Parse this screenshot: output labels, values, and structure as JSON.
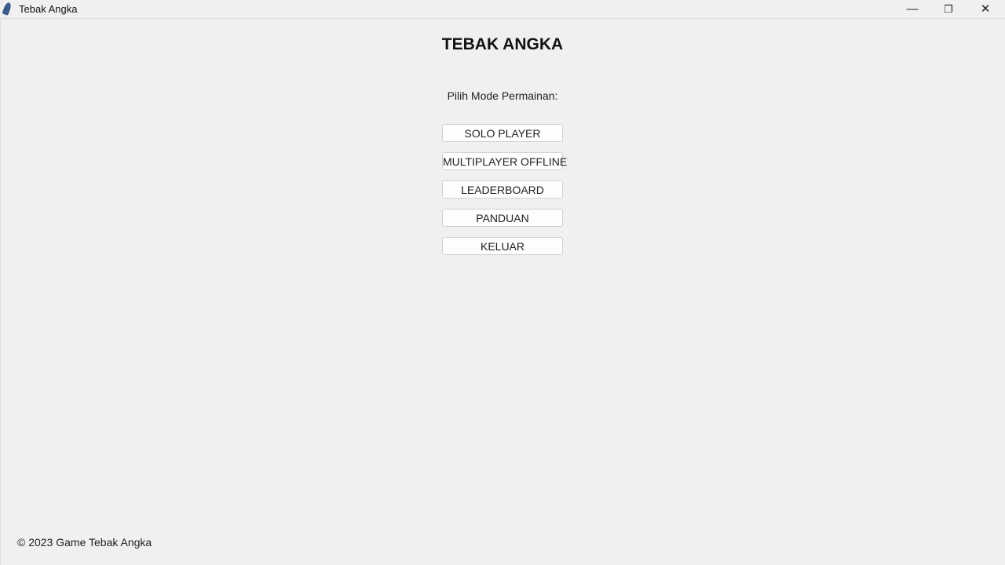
{
  "window": {
    "title": "Tebak Angka",
    "minimize": "—",
    "maximize": "❐",
    "close": "✕"
  },
  "main": {
    "heading": "TEBAK ANGKA",
    "subtitle": "Pilih Mode Permainan:",
    "buttons": [
      "SOLO PLAYER",
      "MULTIPLAYER OFFLINE",
      "LEADERBOARD",
      "PANDUAN",
      "KELUAR"
    ]
  },
  "footer": "© 2023 Game Tebak Angka"
}
